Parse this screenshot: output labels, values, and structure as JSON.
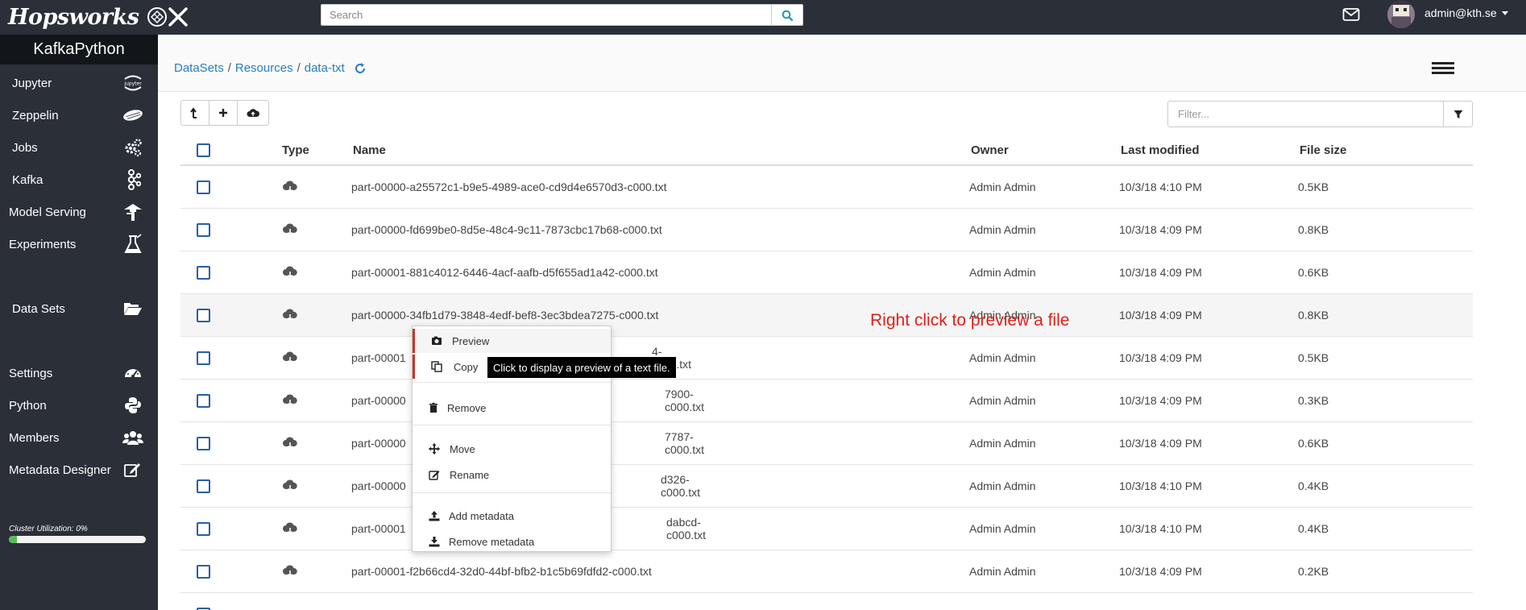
{
  "topbar": {
    "logo_text": "Hopsworks",
    "search_placeholder": "Search",
    "user_email": "admin@kth.se"
  },
  "sidebar": {
    "project_name": "KafkaPython",
    "items": [
      {
        "label": "Jupyter",
        "icon": "jupyter-icon"
      },
      {
        "label": "Zeppelin",
        "icon": "zeppelin-icon"
      },
      {
        "label": "Jobs",
        "icon": "gears-icon"
      },
      {
        "label": "Kafka",
        "icon": "kafka-icon"
      },
      {
        "label": "Model Serving",
        "icon": "serving-icon"
      },
      {
        "label": "Experiments",
        "icon": "flask-icon"
      },
      {
        "label": "Data Sets",
        "icon": "folder-open-icon"
      },
      {
        "label": "Settings",
        "icon": "dashboard-icon"
      },
      {
        "label": "Python",
        "icon": "python-icon"
      },
      {
        "label": "Members",
        "icon": "users-icon"
      },
      {
        "label": "Metadata Designer",
        "icon": "edit-icon"
      }
    ],
    "cluster_label": "Cluster Utilization: 0%",
    "cluster_percent": 0
  },
  "breadcrumb": {
    "items": [
      "DataSets",
      "Resources",
      "data-txt"
    ],
    "separator": "/"
  },
  "filter": {
    "placeholder": "Filter..."
  },
  "table": {
    "headers": {
      "type": "Type",
      "name": "Name",
      "owner": "Owner",
      "modified": "Last modified",
      "size": "File size"
    },
    "rows": [
      {
        "name": "part-00000-a25572c1-b9e5-4989-ace0-cd9d4e6570d3-c000.txt",
        "owner": "Admin Admin",
        "modified": "10/3/18 4:10 PM",
        "size": "0.5KB"
      },
      {
        "name": "part-00000-fd699be0-8d5e-48c4-9c11-7873cbc17b68-c000.txt",
        "owner": "Admin Admin",
        "modified": "10/3/18 4:09 PM",
        "size": "0.8KB"
      },
      {
        "name": "part-00001-881c4012-6446-4acf-aafb-d5f655ad1a42-c000.txt",
        "owner": "Admin Admin",
        "modified": "10/3/18 4:09 PM",
        "size": "0.6KB"
      },
      {
        "name": "part-00000-34fb1d79-3848-4edf-bef8-3ec3bdea7275-c000.txt",
        "owner": "Admin Admin",
        "modified": "10/3/18 4:09 PM",
        "size": "0.8KB"
      },
      {
        "name": "part-00001",
        "name_tail": "4-c000.txt",
        "owner": "Admin Admin",
        "modified": "10/3/18 4:09 PM",
        "size": "0.5KB"
      },
      {
        "name": "part-00000",
        "name_tail": "7900-c000.txt",
        "owner": "Admin Admin",
        "modified": "10/3/18 4:09 PM",
        "size": "0.3KB"
      },
      {
        "name": "part-00000",
        "name_tail": "7787-c000.txt",
        "owner": "Admin Admin",
        "modified": "10/3/18 4:09 PM",
        "size": "0.6KB"
      },
      {
        "name": "part-00000",
        "name_tail": "d326-c000.txt",
        "owner": "Admin Admin",
        "modified": "10/3/18 4:10 PM",
        "size": "0.4KB"
      },
      {
        "name": "part-00001",
        "name_tail": "dabcd-c000.txt",
        "owner": "Admin Admin",
        "modified": "10/3/18 4:10 PM",
        "size": "0.4KB"
      },
      {
        "name": "part-00001-f2b66cd4-32d0-44bf-bfb2-b1c5b69fdfd2-c000.txt",
        "owner": "Admin Admin",
        "modified": "10/3/18 4:09 PM",
        "size": "0.2KB"
      }
    ]
  },
  "hint_text": "Right click to preview a file",
  "context_menu": {
    "items": [
      "Preview",
      "Copy",
      "Remove",
      "Move",
      "Rename",
      "Add metadata",
      "Remove metadata"
    ]
  },
  "tooltip_text": "Click to display a preview of a text file."
}
